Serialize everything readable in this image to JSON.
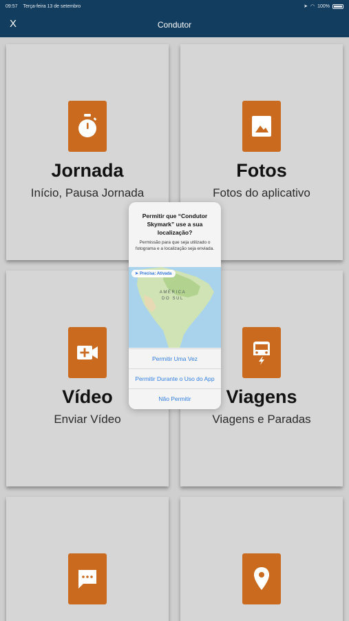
{
  "statusbar": {
    "time": "09:57",
    "date": "Terça-feira 13 de setembro",
    "battery": "100%"
  },
  "navbar": {
    "close_label": "X",
    "title": "Condutor"
  },
  "tiles": [
    {
      "title": "Jornada",
      "subtitle": "Início, Pausa Jornada",
      "icon": "stopwatch-icon"
    },
    {
      "title": "Fotos",
      "subtitle": "Fotos do aplicativo",
      "icon": "photo-icon"
    },
    {
      "title": "Vídeo",
      "subtitle": "Enviar Vídeo",
      "icon": "video-add-icon"
    },
    {
      "title": "Viagens",
      "subtitle": "Viagens e Paradas",
      "icon": "car-icon"
    },
    {
      "title": "",
      "subtitle": "",
      "icon": "message-icon"
    },
    {
      "title": "",
      "subtitle": "",
      "icon": "location-pin-icon"
    }
  ],
  "dialog": {
    "question": "Permitir que “Condutor Skymark” use a sua localização?",
    "description": "Permissão para que seja utilizado o fotograma e a localização seja enviada.",
    "precise_label": "Precisa: Ativada",
    "map_label": "AMÉRICA DO SUL",
    "options": [
      "Permitir Uma Vez",
      "Permitir Durante o Uso do App",
      "Não Permitir"
    ]
  },
  "colors": {
    "navbar": "#123d5e",
    "accent": "#c96a1f",
    "tile": "#d6d6d6",
    "link": "#2f7de1"
  }
}
